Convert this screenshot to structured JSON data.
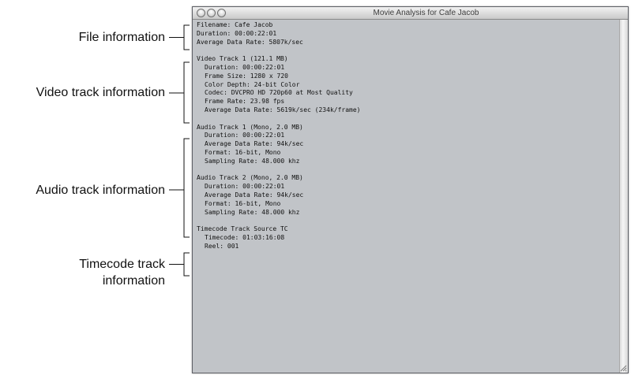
{
  "window": {
    "title": "Movie Analysis for Cafe Jacob"
  },
  "callouts": {
    "file": "File information",
    "video": "Video track information",
    "audio": "Audio track information",
    "timecode_line1": "Timecode track",
    "timecode_line2": "information"
  },
  "file_info": {
    "filename": "Filename: Cafe Jacob",
    "duration": "Duration: 00:00:22:01",
    "data_rate": "Average Data Rate: 5807k/sec"
  },
  "video_track": {
    "header": "Video Track 1 (121.1 MB)",
    "duration": "Duration: 00:00:22:01",
    "frame_size": "Frame Size: 1280 x 720",
    "color_depth": "Color Depth: 24-bit Color",
    "codec": "Codec: DVCPRO HD 720p60 at Most Quality",
    "frame_rate": "Frame Rate: 23.98 fps",
    "data_rate": "Average Data Rate: 5619k/sec (234k/frame)"
  },
  "audio_track_1": {
    "header": "Audio Track 1 (Mono, 2.0 MB)",
    "duration": "Duration: 00:00:22:01",
    "data_rate": "Average Data Rate: 94k/sec",
    "format": "Format: 16-bit, Mono",
    "sampling": "Sampling Rate: 48.000 khz"
  },
  "audio_track_2": {
    "header": "Audio Track 2 (Mono, 2.0 MB)",
    "duration": "Duration: 00:00:22:01",
    "data_rate": "Average Data Rate: 94k/sec",
    "format": "Format: 16-bit, Mono",
    "sampling": "Sampling Rate: 48.000 khz"
  },
  "timecode_track": {
    "header": "Timecode Track Source TC",
    "timecode": "Timecode: 01:03:16:08",
    "reel": "Reel: 001"
  },
  "colors": {
    "window_background": "#c1c4c8",
    "bracket_line": "#111111"
  }
}
